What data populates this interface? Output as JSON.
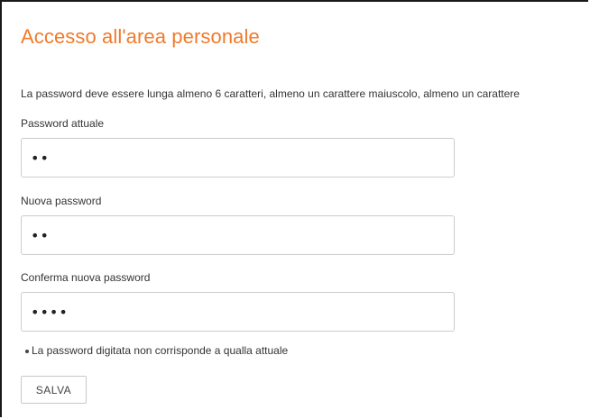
{
  "page": {
    "title": "Accesso all'area personale",
    "password_rules": "La password deve essere lunga almeno 6 caratteri, almeno un carattere maiuscolo, almeno un carattere"
  },
  "form": {
    "current_password": {
      "label": "Password attuale",
      "value": "••"
    },
    "new_password": {
      "label": "Nuova password",
      "value": "••"
    },
    "confirm_password": {
      "label": "Conferma nuova password",
      "value": "••••"
    },
    "errors": [
      "La password digitata non corrisponde a qualla attuale"
    ],
    "save_label": "SALVA"
  },
  "colors": {
    "title": "#f07a2a",
    "text": "#333333",
    "border": "#cccccc"
  }
}
